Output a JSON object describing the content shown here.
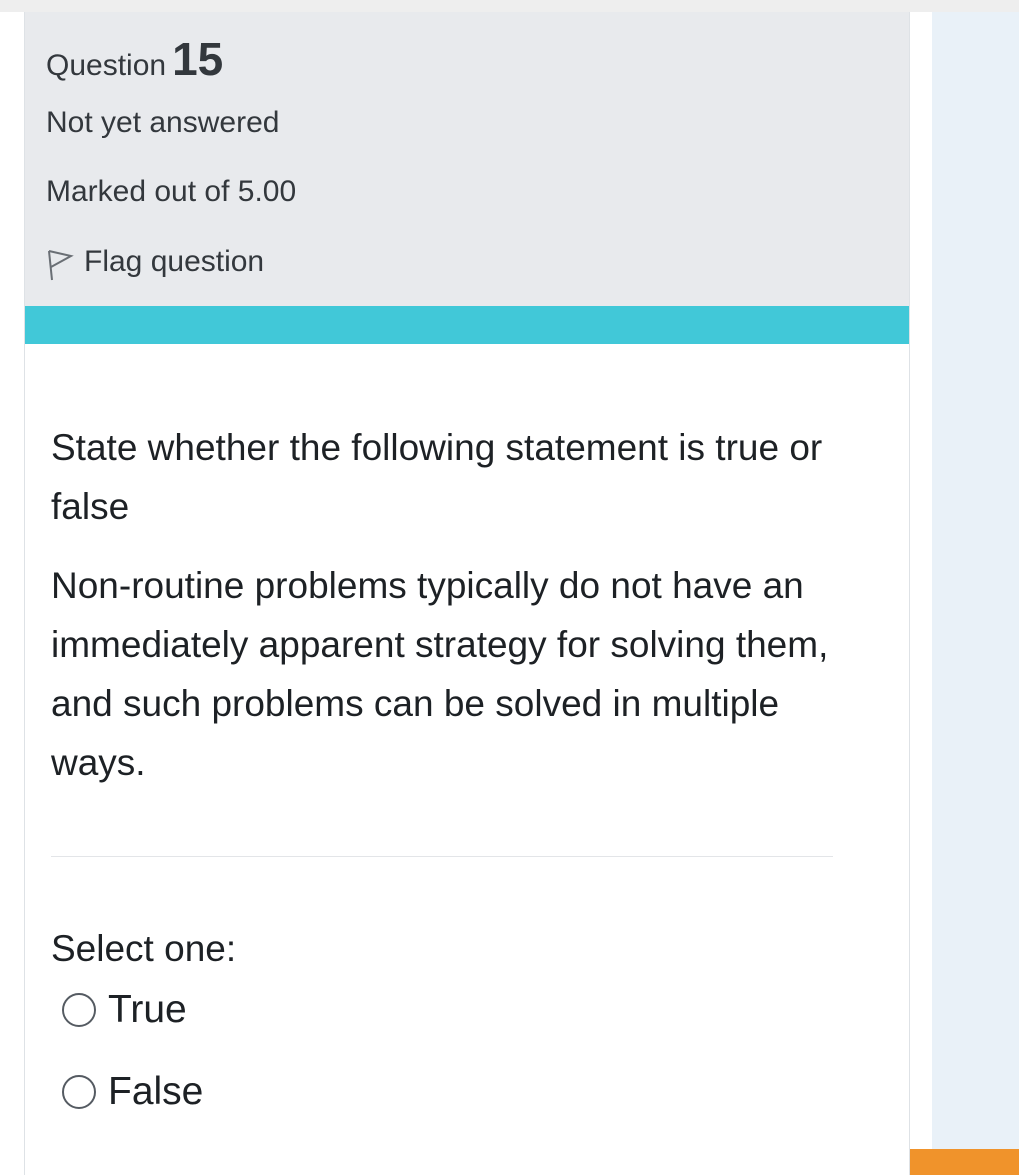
{
  "question": {
    "number_label": "Question",
    "number": "15",
    "state": "Not yet answered",
    "grade": "Marked out of 5.00",
    "flag_label": "Flag question",
    "flag_icon": "flag-outline-icon"
  },
  "content": {
    "instruction": "State whether the following statement is true or false",
    "statement": "Non-routine problems typically do not have an immediately apparent strategy for solving them, and such problems can be solved in multiple ways.",
    "prompt": "Select one:",
    "options": [
      {
        "label": "True",
        "selected": false
      },
      {
        "label": "False",
        "selected": false
      }
    ]
  },
  "colors": {
    "info_background": "#e8eaed",
    "accent_band": "#41c8d8",
    "side_panel": "#e9f1f8",
    "side_accent": "#f0932b"
  }
}
